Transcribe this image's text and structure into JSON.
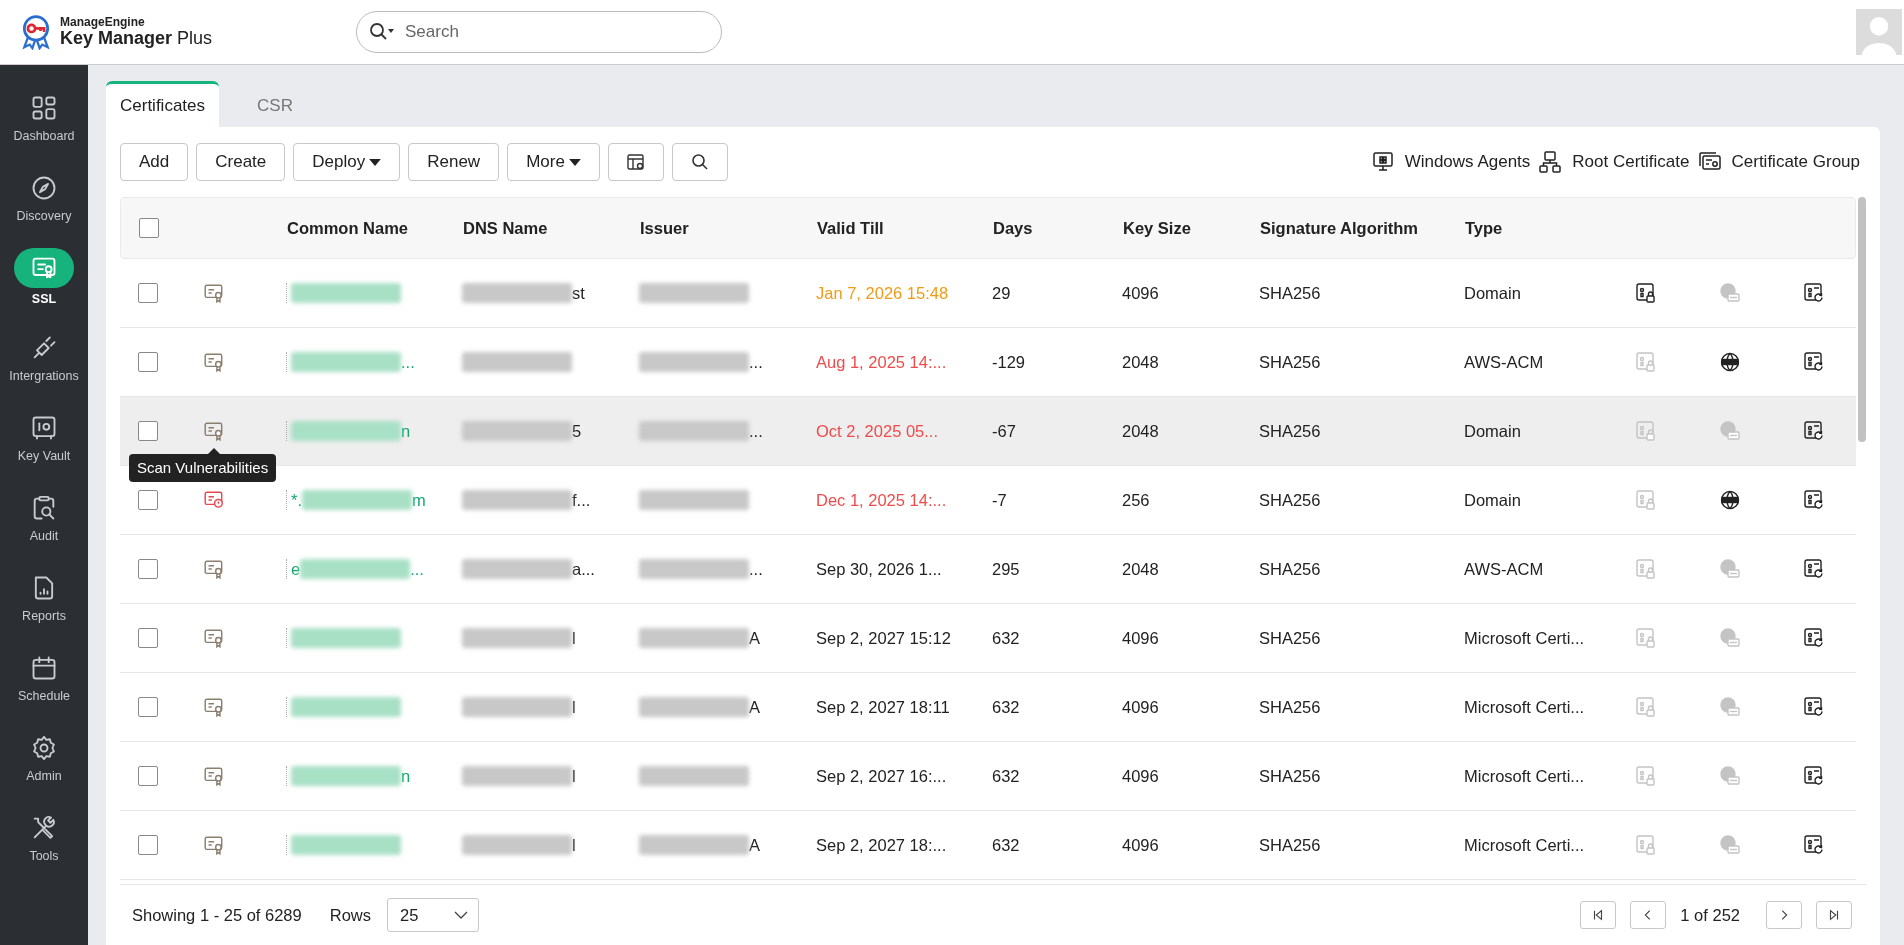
{
  "header": {
    "brand_top": "ManageEngine",
    "brand_name": "Key Manager",
    "brand_suffix": "Plus",
    "search": {
      "placeholder": "Search"
    }
  },
  "sidebar": {
    "items": [
      {
        "label": "Dashboard",
        "selected": false
      },
      {
        "label": "Discovery",
        "selected": false
      },
      {
        "label": "SSL",
        "selected": true
      },
      {
        "label": "Intergrations",
        "selected": false
      },
      {
        "label": "Key Vault",
        "selected": false
      },
      {
        "label": "Audit",
        "selected": false
      },
      {
        "label": "Reports",
        "selected": false
      },
      {
        "label": "Schedule",
        "selected": false
      },
      {
        "label": "Admin",
        "selected": false
      },
      {
        "label": "Tools",
        "selected": false
      }
    ]
  },
  "tabs": [
    {
      "label": "Certificates",
      "selected": true
    },
    {
      "label": "CSR",
      "selected": false
    }
  ],
  "toolbar": {
    "buttons": [
      {
        "label": "Add",
        "kind": "plain"
      },
      {
        "label": "Create",
        "kind": "plain"
      },
      {
        "label": "Deploy",
        "kind": "dropdown"
      },
      {
        "label": "Renew",
        "kind": "plain"
      },
      {
        "label": "More",
        "kind": "dropdown"
      },
      {
        "kind": "columns"
      },
      {
        "kind": "search"
      }
    ],
    "links": [
      "Windows Agents",
      "Root Certificate",
      "Certificate Group"
    ]
  },
  "table": {
    "header_checked": false,
    "columns": [
      "Common Name",
      "DNS Name",
      "Issuer",
      "Valid Till",
      "Days",
      "Key Size",
      "Signature Algorithm",
      "Type"
    ],
    "rows": [
      {
        "checked": false,
        "hovered": false,
        "alert": false,
        "common_name": {},
        "dns_name": "st",
        "valid_till": "Jan 7, 2026 15:48",
        "expiring": true,
        "expired": false,
        "days": "29",
        "key_size": "4096",
        "algorithm": "SHA256",
        "type": "Domain",
        "actions": [
          {
            "kind": "lock",
            "enabled": true
          },
          {
            "kind": "globe",
            "enabled": false
          },
          {
            "kind": "renew",
            "enabled": true
          }
        ]
      },
      {
        "checked": false,
        "hovered": false,
        "alert": false,
        "common_name": {
          "text": "..."
        },
        "issuer": "...",
        "valid_till": "Aug 1, 2025 14:...",
        "expiring": false,
        "expired": true,
        "days": "-129",
        "key_size": "2048",
        "algorithm": "SHA256",
        "type": "AWS-ACM",
        "actions": [
          {
            "kind": "lock",
            "enabled": false
          },
          {
            "kind": "dns",
            "enabled": true
          },
          {
            "kind": "renew",
            "enabled": true
          }
        ]
      },
      {
        "checked": false,
        "hovered": true,
        "alert": false,
        "tooltip": "Scan Vulnerabilities",
        "common_name": {
          "text": "n"
        },
        "dns_name": "5",
        "issuer": "...",
        "valid_till": "Oct 2, 2025 05...",
        "expiring": false,
        "expired": true,
        "days": "-67",
        "key_size": "2048",
        "algorithm": "SHA256",
        "type": "Domain",
        "actions": [
          {
            "kind": "lock",
            "enabled": false
          },
          {
            "kind": "globe",
            "enabled": false
          },
          {
            "kind": "renew",
            "enabled": true
          }
        ]
      },
      {
        "checked": false,
        "hovered": false,
        "alert": true,
        "common_name": {
          "prefix": "*.",
          "text": "m"
        },
        "dns_name": "f...",
        "valid_till": "Dec 1, 2025 14:...",
        "expiring": false,
        "expired": true,
        "days": "-7",
        "key_size": "256",
        "algorithm": "SHA256",
        "type": "Domain",
        "actions": [
          {
            "kind": "lock",
            "enabled": false
          },
          {
            "kind": "dns",
            "enabled": true
          },
          {
            "kind": "renew",
            "enabled": true
          }
        ]
      },
      {
        "checked": false,
        "hovered": false,
        "alert": false,
        "common_name": {
          "prefix": "e",
          "text": "..."
        },
        "dns_name": "a...",
        "issuer": "...",
        "valid_till": "Sep 30, 2026 1...",
        "expiring": false,
        "expired": false,
        "days": "295",
        "key_size": "2048",
        "algorithm": "SHA256",
        "type": "AWS-ACM",
        "actions": [
          {
            "kind": "lock",
            "enabled": false
          },
          {
            "kind": "globe",
            "enabled": false
          },
          {
            "kind": "renew",
            "enabled": true
          }
        ]
      },
      {
        "checked": false,
        "hovered": false,
        "alert": false,
        "common_name": {},
        "dns_name": "l",
        "issuer": "A",
        "valid_till": "Sep 2, 2027 15:12",
        "expiring": false,
        "expired": false,
        "days": "632",
        "key_size": "4096",
        "algorithm": "SHA256",
        "type": "Microsoft Certi...",
        "actions": [
          {
            "kind": "lock",
            "enabled": false
          },
          {
            "kind": "globe",
            "enabled": false
          },
          {
            "kind": "renew",
            "enabled": true
          }
        ]
      },
      {
        "checked": false,
        "hovered": false,
        "alert": false,
        "common_name": {},
        "dns_name": "l",
        "issuer": "A",
        "valid_till": "Sep 2, 2027 18:11",
        "expiring": false,
        "expired": false,
        "days": "632",
        "key_size": "4096",
        "algorithm": "SHA256",
        "type": "Microsoft Certi...",
        "actions": [
          {
            "kind": "lock",
            "enabled": false
          },
          {
            "kind": "globe",
            "enabled": false
          },
          {
            "kind": "renew",
            "enabled": true
          }
        ]
      },
      {
        "checked": false,
        "hovered": false,
        "alert": false,
        "common_name": {
          "text": "n"
        },
        "dns_name": "l",
        "valid_till": "Sep 2, 2027 16:...",
        "expiring": false,
        "expired": false,
        "days": "632",
        "key_size": "4096",
        "algorithm": "SHA256",
        "type": "Microsoft Certi...",
        "actions": [
          {
            "kind": "lock",
            "enabled": false
          },
          {
            "kind": "globe",
            "enabled": false
          },
          {
            "kind": "renew",
            "enabled": true
          }
        ]
      },
      {
        "checked": false,
        "hovered": false,
        "alert": false,
        "common_name": {},
        "dns_name": "l",
        "issuer": "A",
        "valid_till": "Sep 2, 2027 18:...",
        "expiring": false,
        "expired": false,
        "days": "632",
        "key_size": "4096",
        "algorithm": "SHA256",
        "type": "Microsoft Certi...",
        "actions": [
          {
            "kind": "lock",
            "enabled": false
          },
          {
            "kind": "globe",
            "enabled": false
          },
          {
            "kind": "renew",
            "enabled": true
          }
        ]
      }
    ]
  },
  "footer": {
    "showing": "Showing 1 - 25 of 6289",
    "rows_label": "Rows",
    "rows_value": "25",
    "page": "1 of 252"
  }
}
